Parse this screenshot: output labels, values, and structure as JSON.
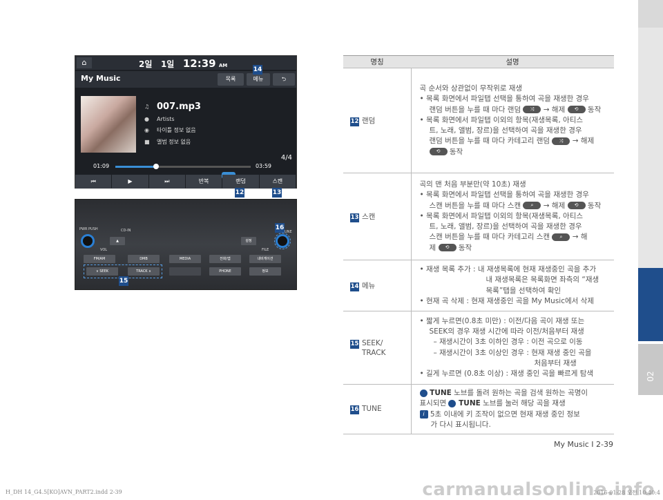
{
  "side": {
    "chapter": "02"
  },
  "screen": {
    "home": "⌂",
    "status": {
      "ch1": "2일",
      "ch2": "1일",
      "time": "12:39",
      "ampm": "AM"
    },
    "title": "My Music",
    "btn_list": "목록",
    "btn_menu": "메뉴",
    "btn_back": "⮌",
    "track": "007.mp3",
    "artist": "Artists",
    "no_title": "타이틀 정보 없음",
    "no_album": "앨범 정보 없음",
    "count": "4/4",
    "time_cur": "01:09",
    "time_tot": "03:59",
    "progress": 0.3,
    "ctrl": [
      "⏮",
      "▶",
      "⏭",
      "반복",
      "랜덤",
      "스캔"
    ]
  },
  "console": {
    "power": "PWR PUSH",
    "vol": "VOL",
    "file": "FILE",
    "tune": "TUNE",
    "setup": "설정",
    "row1": [
      "FM/AM",
      "DMB",
      "MEDIA",
      "전화/앱",
      "내비게이션"
    ],
    "row2": [
      "∨ SEEK",
      "TRACK ∧",
      "",
      "PHONE",
      "정보"
    ],
    "disc": "CD-IN"
  },
  "tags": {
    "t12": "12",
    "t13": "13",
    "t14": "14",
    "t15": "15",
    "t16": "16"
  },
  "table": {
    "h_name": "명칭",
    "h_desc": "설명",
    "r12": {
      "num": "12",
      "name": "랜덤",
      "l1": "곡 순서와 상관없이 무작위로 재생",
      "l2": "목록 화면에서 파일탭 선택을 통하여 곡을 재생한 경우",
      "l3a": "랜덤 버튼을 누를 때 마다 랜덤 ",
      "l3b": " → 해제 ",
      "l3c": " 동작",
      "l4": "목록 화면에서 파일탭 이외의 항목(재생목록, 아티스",
      "l5": "트, 노래, 앨범, 장르)을 선택하여 곡을 재생한 경우",
      "l6a": "랜덤 버튼을 누를 때 마다 카테고리 랜덤 ",
      "l6b": " → 해제",
      "l7": " 동작"
    },
    "r13": {
      "num": "13",
      "name": "스캔",
      "l1": "곡의 맨 처음 부분만(약 10초) 재생",
      "l2": "목록 화면에서 파일탭 선택을 통하여 곡을 재생한 경우",
      "l3a": "스캔 버튼을 누를 때 마다 스캔 ",
      "l3b": " → 해제 ",
      "l3c": " 동작",
      "l4": "목록 화면에서 파일탭 이외의 항목(재생목록, 아티스",
      "l5": "트, 노래, 앨범, 장르)을 선택하여 곡을 재생한 경우",
      "l6a": "스캔 버튼을 누를 때 마다 카테고리 스캔 ",
      "l6b": " → 해",
      "l7a": "제 ",
      "l7b": " 동작"
    },
    "r14": {
      "num": "14",
      "name": "메뉴",
      "l1": "재생 목록 추가 : 내 재생목록에 현재 재생중인 곡을 추가",
      "l2": "내 재생목록은 목록화면 좌측의 “재생",
      "l3": "목록”탭을 선택하여 확인",
      "l4": "현재 곡 삭제 : 현재 재생중인 곡을 My Music에서 삭제"
    },
    "r15": {
      "num": "15",
      "name": "SEEK/",
      "name2": "TRACK",
      "l1": "짧게 누르면(0.8초 미만) : 이전/다음 곡이 재생 또는",
      "l2": "SEEK의 경우 재생 시간에 따라 이전/처음부터 재생",
      "l3": "– 재생시간이 3초 이하인 경우 : 이전 곡으로 이동",
      "l4": "– 재생시간이 3초 이상인 경우 : 현재 재생 중인 곡을",
      "l5": "처음부터 재생",
      "l6": "길게 누르면 (0.8초 이상) : 재생 중인 곡을 빠르게 탐색"
    },
    "r16": {
      "num": "16",
      "name": "TUNE",
      "l1a": " TUNE",
      "l1b": " 노브를 돌려 원하는 곡을 검색 원하는 곡명이",
      "l2a": "표시되면 ",
      "l2b": " TUNE",
      "l2c": " 노브를 눌러 해당 곡을 재생",
      "l3": " 5초 이내에 키 조작이 없으면 현재 재생 중인 정보",
      "l4": "가 다시 표시됩니다.",
      "info": "i"
    }
  },
  "footer": {
    "page": "My Music I 2-39",
    "file": "H_DH 14_G4.5[KO]AVN_PART2.indd   2-39",
    "date": "2016-01-28   오전 10:40:4",
    "watermark": "carmanualsonline.info"
  },
  "colors": {
    "accent": "#1f4e8c",
    "highlight": "#3a8fd6"
  }
}
